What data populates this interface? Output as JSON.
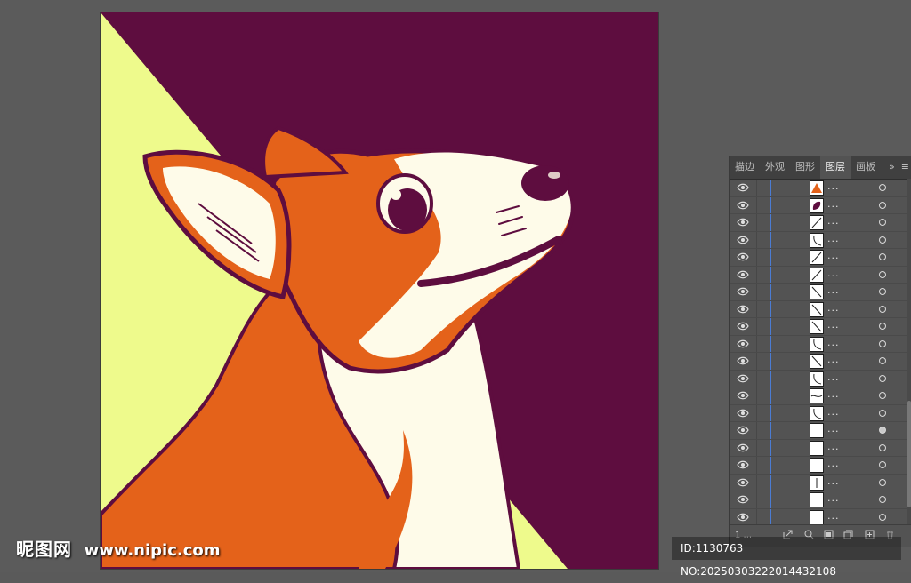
{
  "panel": {
    "tabs": [
      {
        "label": "描边"
      },
      {
        "label": "外观"
      },
      {
        "label": "图形"
      },
      {
        "label": "图层"
      },
      {
        "label": "画板"
      }
    ],
    "more_glyph": "»",
    "menu_glyph": "≡",
    "layer_name": "...",
    "footer_count": "1 ..."
  },
  "layers": [
    {
      "thumb": "orange-shape"
    },
    {
      "thumb": "purple-shape"
    },
    {
      "thumb": "stroke-diag"
    },
    {
      "thumb": "stroke-curve"
    },
    {
      "thumb": "stroke-diag"
    },
    {
      "thumb": "stroke-diag"
    },
    {
      "thumb": "stroke-back"
    },
    {
      "thumb": "stroke-back"
    },
    {
      "thumb": "stroke-back"
    },
    {
      "thumb": "stroke-curve"
    },
    {
      "thumb": "stroke-back"
    },
    {
      "thumb": "stroke-curve"
    },
    {
      "thumb": "stroke-wave"
    },
    {
      "thumb": "stroke-curve"
    },
    {
      "thumb": "blank",
      "selected": true
    },
    {
      "thumb": "blank"
    },
    {
      "thumb": "blank"
    },
    {
      "thumb": "stroke-vert"
    },
    {
      "thumb": "blank"
    },
    {
      "thumb": "blank"
    },
    {
      "thumb": "purple-fill"
    }
  ],
  "watermark": {
    "brand": "昵图网",
    "url": "www.nipic.com",
    "id_text": "ID:1130763 NO:20250303222014432108"
  },
  "colors": {
    "background_purple": "#5e0d3f",
    "background_yellow": "#eefa8c",
    "fur_orange": "#e4621a",
    "cream": "#fefbe9",
    "outline": "#5e0d3f",
    "layer_color_bar": "#4b7cd3"
  }
}
